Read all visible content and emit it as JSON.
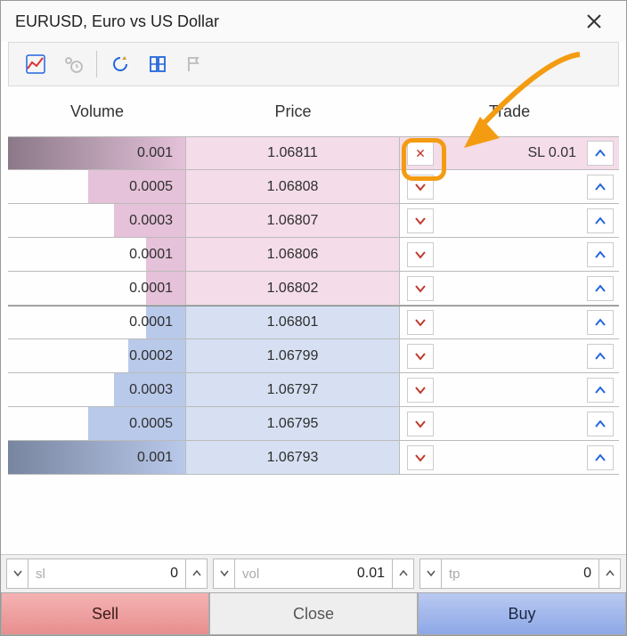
{
  "window": {
    "title": "EURUSD, Euro vs US Dollar"
  },
  "headers": {
    "volume": "Volume",
    "price": "Price",
    "trade": "Trade"
  },
  "ask_color": "#f4dce9",
  "bid_color": "#d6e0f2",
  "volbar_ask": "#e5c2d9",
  "volbar_bid": "#b9c9ea",
  "volbar_ask_dark": "#8a7888",
  "volbar_bid_dark": "#7885a0",
  "rows": [
    {
      "side": "ask",
      "barFill": "dark",
      "volume": "0.001",
      "price": "1.06811",
      "barPct": 100,
      "sl": "SL 0.01",
      "close": true
    },
    {
      "side": "ask",
      "volume": "0.0005",
      "price": "1.06808",
      "barPct": 55
    },
    {
      "side": "ask",
      "volume": "0.0003",
      "price": "1.06807",
      "barPct": 40
    },
    {
      "side": "ask",
      "volume": "0.0001",
      "price": "1.06806",
      "barPct": 22
    },
    {
      "side": "ask",
      "volume": "0.0001",
      "price": "1.06802",
      "barPct": 22
    },
    {
      "side": "bid",
      "spread": true,
      "volume": "0.0001",
      "price": "1.06801",
      "barPct": 22
    },
    {
      "side": "bid",
      "volume": "0.0002",
      "price": "1.06799",
      "barPct": 32
    },
    {
      "side": "bid",
      "volume": "0.0003",
      "price": "1.06797",
      "barPct": 40
    },
    {
      "side": "bid",
      "volume": "0.0005",
      "price": "1.06795",
      "barPct": 55
    },
    {
      "side": "bid",
      "barFill": "dark",
      "volume": "0.001",
      "price": "1.06793",
      "barPct": 100
    }
  ],
  "inputs": {
    "sl": {
      "label": "sl",
      "value": "0"
    },
    "vol": {
      "label": "vol",
      "value": "0.01"
    },
    "tp": {
      "label": "tp",
      "value": "0"
    }
  },
  "actions": {
    "sell": "Sell",
    "close": "Close",
    "buy": "Buy"
  },
  "annot": {
    "arrow_color": "#f39c12"
  }
}
